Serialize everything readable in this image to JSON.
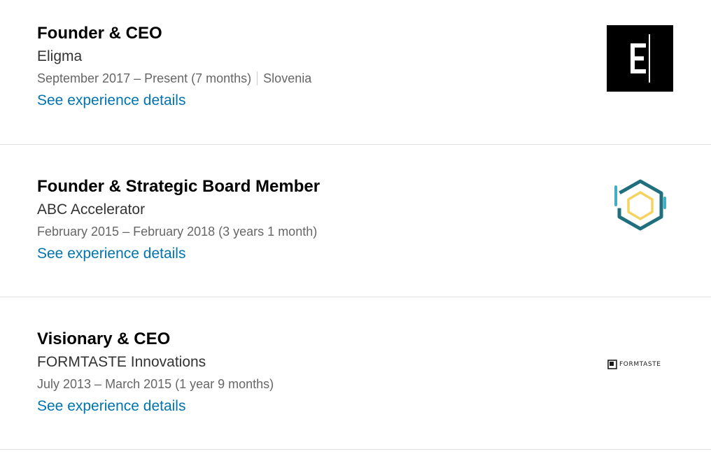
{
  "experiences": [
    {
      "title": "Founder & CEO",
      "company": "Eligma",
      "dates": "September 2017 – Present (7 months)",
      "location": "Slovenia",
      "link_label": "See experience details",
      "logo_icon": "eligma-logo",
      "logo_letter": "E"
    },
    {
      "title": "Founder & Strategic Board Member",
      "company": "ABC Accelerator",
      "dates": "February 2015 – February 2018 (3 years 1 month)",
      "link_label": "See experience details",
      "logo_icon": "abc-accelerator-logo"
    },
    {
      "title": "Visionary & CEO",
      "company": "FORMTASTE Innovations",
      "dates": "July 2013 – March 2015 (1 year 9 months)",
      "link_label": "See experience details",
      "logo_icon": "formtaste-logo",
      "logo_wordmark": "FORMTASTE"
    }
  ],
  "colors": {
    "link": "#0073b1",
    "divider": "#e0e0e0",
    "hex_outer": "#1f6f7f",
    "hex_inner": "#f4d35e",
    "hex_accent": "#3fb0c4"
  }
}
